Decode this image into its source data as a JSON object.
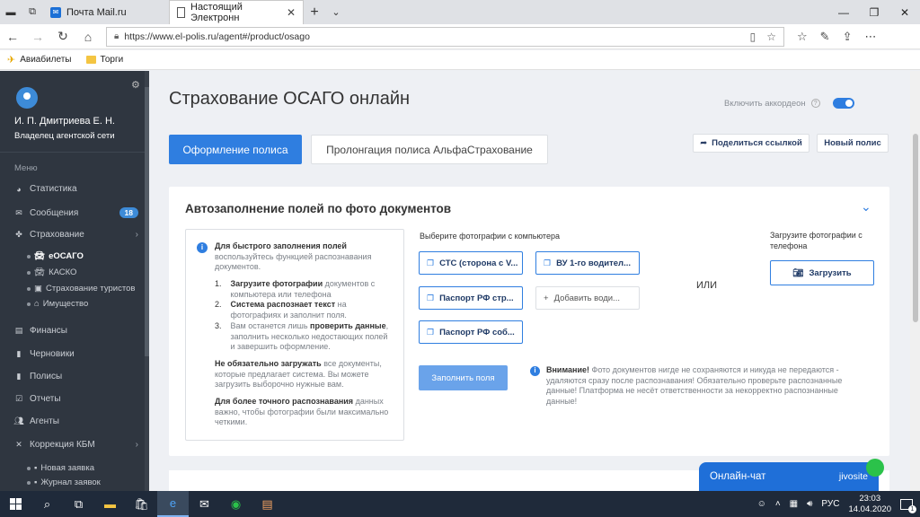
{
  "browser": {
    "tabs": [
      {
        "label": "Почта Mail.ru",
        "active": false
      },
      {
        "label": "Настоящий Электронн",
        "active": true
      }
    ],
    "new_tab": "+",
    "url": "https://www.el-polis.ru/agent#/product/osago",
    "bookmarks": [
      "Авиабилеты",
      "Торги"
    ]
  },
  "sidebar": {
    "user_name": "И. П. Дмитриева Е. Н.",
    "user_role": "Владелец агентской сети",
    "menu_label": "Меню",
    "items": [
      {
        "label": "Статистика",
        "icon": "chart-pie-icon"
      },
      {
        "label": "Сообщения",
        "icon": "envelope-icon",
        "badge": "18"
      },
      {
        "label": "Страхование",
        "icon": "insurance-icon",
        "has_children": true
      },
      {
        "label": "Финансы",
        "icon": "money-icon"
      },
      {
        "label": "Черновики",
        "icon": "draft-icon"
      },
      {
        "label": "Полисы",
        "icon": "document-icon"
      },
      {
        "label": "Отчеты",
        "icon": "report-icon"
      },
      {
        "label": "Агенты",
        "icon": "users-icon"
      },
      {
        "label": "Коррекция КБМ",
        "icon": "shuffle-icon",
        "has_children": true
      }
    ],
    "insurance_sub": [
      {
        "label": "еОСАГО",
        "active": true
      },
      {
        "label": "КАСКО",
        "active": false
      },
      {
        "label": "Страхование туристов",
        "active": false
      },
      {
        "label": "Имущество",
        "active": false
      }
    ],
    "kbm_sub": [
      {
        "label": "Новая заявка"
      },
      {
        "label": "Журнал заявок"
      }
    ]
  },
  "main": {
    "title": "Страхование ОСАГО онлайн",
    "accordion_label": "Включить аккордеон",
    "accordion_on": true,
    "tab_primary": "Оформление полиса",
    "tab_secondary": "Пролонгация полиса АльфаСтрахование",
    "share_label": "Поделиться ссылкой",
    "new_policy_label": "Новый полис",
    "autofill": {
      "title": "Автозаполнение полей по фото документов",
      "info_head": "Для быстрого заполнения полей",
      "info_head_rest": " воспользуйтесь функцией распознавания документов.",
      "step1_b": "Загрузите фотографии",
      "step1_rest": " документов с компьютера или телефона",
      "step2_b": "Система распознает текст",
      "step2_rest": " на фотографиях и заполнит поля.",
      "step3_pre": "Вам останется лишь ",
      "step3_b": "проверить данные",
      "step3_rest": ", заполнить несколько недостающих полей и завершить оформление.",
      "p2_b": "Не обязательно загружать",
      "p2_rest": " все документы, которые предлагает система. Вы можете загрузить выборочно нужные вам.",
      "p3_b": "Для более точного распознавания",
      "p3_rest": " данных важно, чтобы фотографии были максимально четкими.",
      "choose_label": "Выберите фотографии с компьютера",
      "btn_sts": "СТС (сторона с V...",
      "btn_vu": "ВУ 1-го водител...",
      "btn_passport1": "Паспорт РФ стр...",
      "btn_add_driver": "Добавить води...",
      "btn_passport2": "Паспорт РФ соб...",
      "or_label": "ИЛИ",
      "phone_label": "Загрузите фотографии с телефона",
      "phone_upload": "Загрузить",
      "fill_btn": "Заполнить поля",
      "warn_b": "Внимание!",
      "warn_rest": " Фото документов нигде не сохраняются и никуда не передаются - удаляются сразу после распознавания! Обязательно проверьте распознанные данные! Платформа не несёт ответственности за некорректно распознанные данные!"
    }
  },
  "chat": {
    "label": "Онлайн-чат",
    "brand": "jivosite"
  },
  "taskbar": {
    "lang": "РУС",
    "time": "23:03",
    "date": "14.04.2020",
    "notifications": "1"
  },
  "colors": {
    "accent": "#2f7ee0",
    "sidebar_bg": "#2f3640",
    "chat_bg": "#1f6fd8"
  }
}
